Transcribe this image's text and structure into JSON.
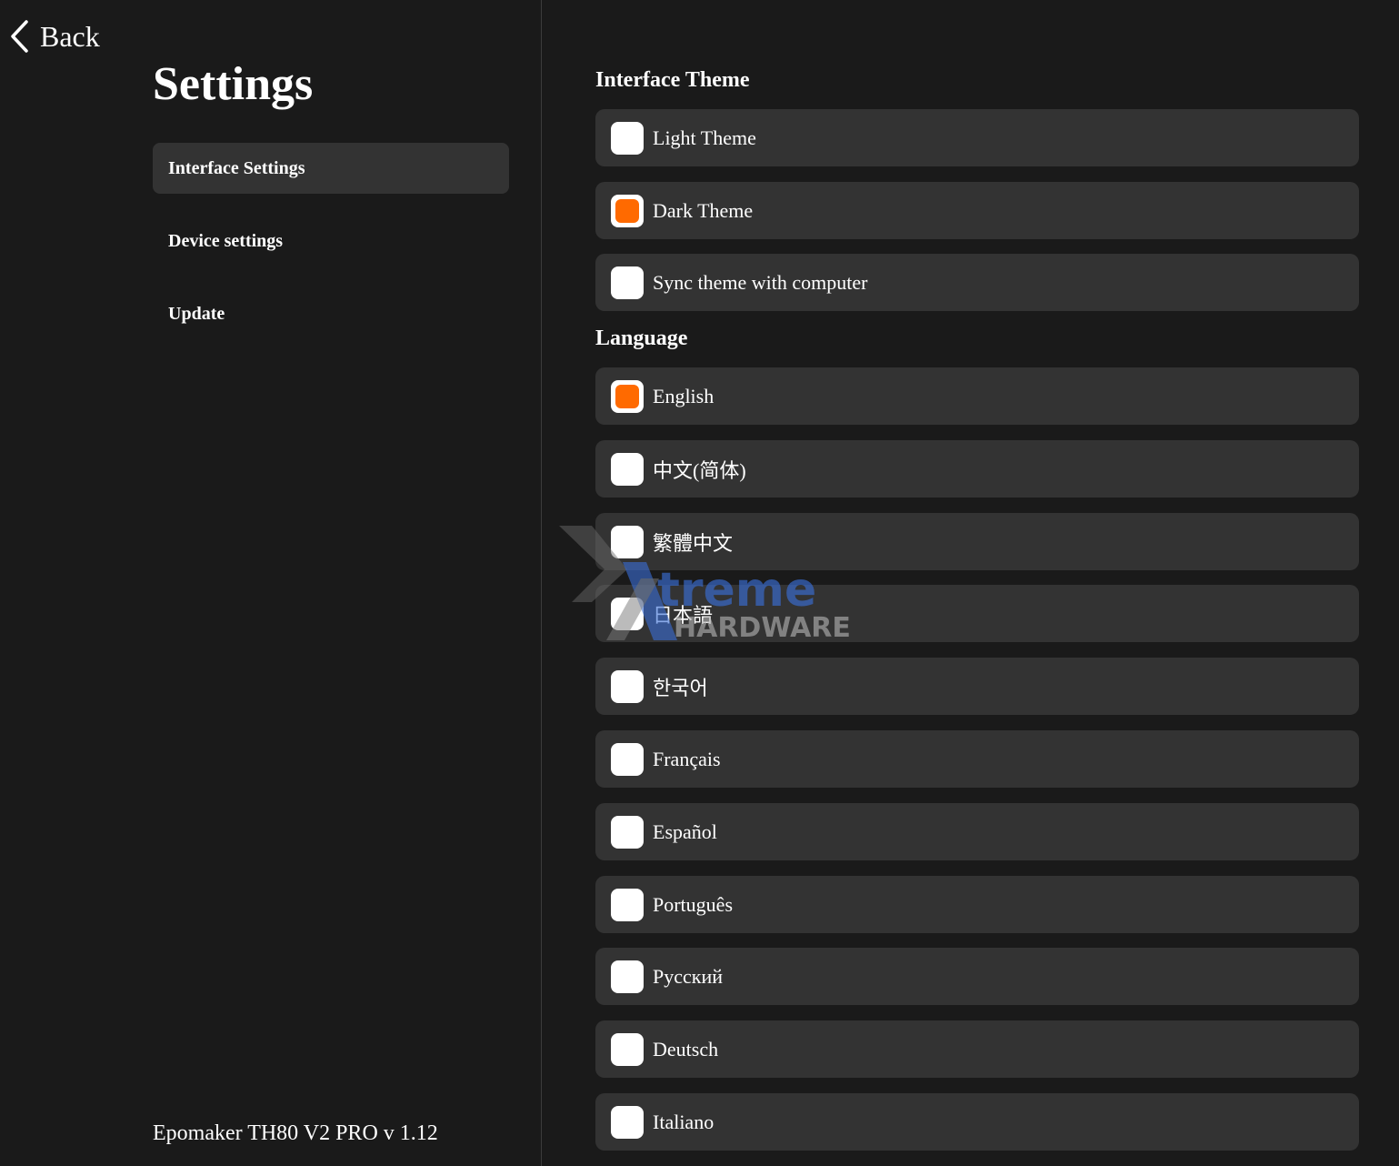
{
  "back": {
    "label": "Back"
  },
  "page_title": "Settings",
  "nav": {
    "items": [
      {
        "label": "Interface Settings",
        "active": true
      },
      {
        "label": "Device settings",
        "active": false
      },
      {
        "label": "Update",
        "active": false
      }
    ]
  },
  "footer": {
    "version": "Epomaker TH80 V2 PRO v 1.12"
  },
  "theme": {
    "title": "Interface Theme",
    "options": [
      {
        "label": "Light Theme",
        "selected": false
      },
      {
        "label": "Dark Theme",
        "selected": true
      },
      {
        "label": "Sync theme with computer",
        "selected": false
      }
    ]
  },
  "language": {
    "title": "Language",
    "options": [
      {
        "label": "English",
        "selected": true
      },
      {
        "label": "中文(简体)",
        "selected": false
      },
      {
        "label": "繁體中文",
        "selected": false
      },
      {
        "label": "日本語",
        "selected": false
      },
      {
        "label": "한국어",
        "selected": false
      },
      {
        "label": "Français",
        "selected": false
      },
      {
        "label": "Español",
        "selected": false
      },
      {
        "label": "Português",
        "selected": false
      },
      {
        "label": "Русский",
        "selected": false
      },
      {
        "label": "Deutsch",
        "selected": false
      },
      {
        "label": "Italiano",
        "selected": false
      }
    ]
  },
  "watermark": {
    "word1": "treme",
    "word2": "HARDWARE"
  },
  "colors": {
    "accent": "#ff6a00",
    "background": "#1a1a1a",
    "card": "#333333",
    "text": "#ffffff"
  }
}
